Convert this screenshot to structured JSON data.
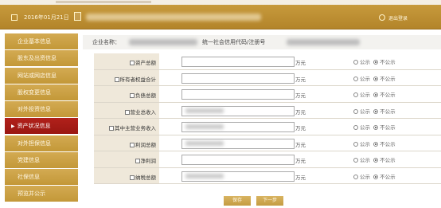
{
  "header": {
    "date": "2016年01月21日",
    "exit_label": "退出登录"
  },
  "sidebar": {
    "items": [
      {
        "label": "企业基本信息"
      },
      {
        "label": "股东及出资信息"
      },
      {
        "label": "网站或网店信息"
      },
      {
        "label": "股权变更信息"
      },
      {
        "label": "对外投资信息"
      },
      {
        "label": "资产状况信息",
        "active": true
      },
      {
        "label": "对外担保信息"
      },
      {
        "label": "党建信息"
      },
      {
        "label": "社保信息"
      },
      {
        "label": "预览并公示"
      }
    ]
  },
  "info": {
    "company_label": "企业名称：",
    "credit_label": "统一社会信用代码/注册号"
  },
  "table": {
    "unit": "万元",
    "public_label": "公示",
    "private_label": "不公示",
    "rows": [
      {
        "label": "资产总额"
      },
      {
        "label": "所有者权益合计"
      },
      {
        "label": "负债总额"
      },
      {
        "label": "营业总收入",
        "blurred": true
      },
      {
        "label": "其中主营业务收入",
        "blurred": true
      },
      {
        "label": "利润总额",
        "blurred": true
      },
      {
        "label": "净利润"
      },
      {
        "label": "纳税总额",
        "blurred": true
      }
    ]
  },
  "buttons": {
    "save": "保存",
    "next": "下一步"
  }
}
